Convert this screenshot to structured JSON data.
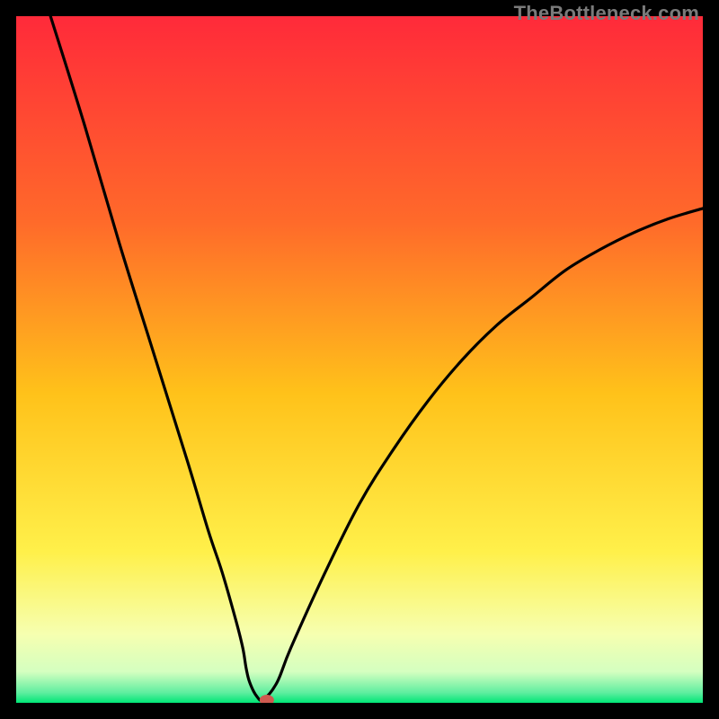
{
  "watermark": "TheBottleneck.com",
  "chart_data": {
    "type": "line",
    "title": "",
    "xlabel": "",
    "ylabel": "",
    "xlim": [
      0,
      100
    ],
    "ylim": [
      0,
      100
    ],
    "grid": false,
    "legend": false,
    "series": [
      {
        "name": "curve",
        "x": [
          5,
          10,
          15,
          20,
          25,
          28,
          30,
          32,
          33,
          33.5,
          34,
          35,
          36,
          38,
          40,
          45,
          50,
          55,
          60,
          65,
          70,
          75,
          80,
          85,
          90,
          95,
          100
        ],
        "y": [
          100,
          84,
          67,
          51,
          35,
          25,
          19,
          12,
          8,
          5,
          3,
          1,
          0.5,
          3,
          8,
          19,
          29,
          37,
          44,
          50,
          55,
          59,
          63,
          66,
          68.5,
          70.5,
          72
        ]
      }
    ],
    "marker": {
      "x": 36.5,
      "y": 0
    },
    "gradient_stops": [
      {
        "offset": 0.0,
        "color": "#ff2a3a"
      },
      {
        "offset": 0.3,
        "color": "#ff6a2a"
      },
      {
        "offset": 0.55,
        "color": "#ffc21a"
      },
      {
        "offset": 0.78,
        "color": "#fff04a"
      },
      {
        "offset": 0.9,
        "color": "#f6ffb0"
      },
      {
        "offset": 0.955,
        "color": "#d4ffc0"
      },
      {
        "offset": 0.985,
        "color": "#60eea0"
      },
      {
        "offset": 1.0,
        "color": "#00e676"
      }
    ]
  }
}
